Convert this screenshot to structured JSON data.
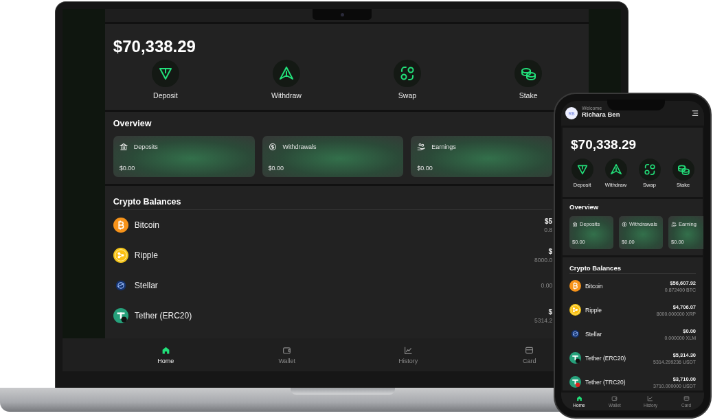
{
  "laptop": {
    "balance": "$70,338.29",
    "actions": [
      {
        "kind": "deposit",
        "label": "Deposit"
      },
      {
        "kind": "withdraw",
        "label": "Withdraw"
      },
      {
        "kind": "swap",
        "label": "Swap"
      },
      {
        "kind": "stake",
        "label": "Stake"
      }
    ],
    "overview": {
      "title": "Overview",
      "cards": [
        {
          "kind": "deposits",
          "label": "Deposits",
          "amount": "$0.00"
        },
        {
          "kind": "withdrawals",
          "label": "Withdrawals",
          "amount": "$0.00"
        },
        {
          "kind": "earnings",
          "label": "Earnings",
          "amount": "$0.00"
        }
      ]
    },
    "crypto": {
      "title": "Crypto Balances",
      "assets": [
        {
          "kind": "bitcoin",
          "name": "Bitcoin",
          "value": "$5",
          "amount": "0.8"
        },
        {
          "kind": "ripple",
          "name": "Ripple",
          "value": "$",
          "amount": "8000.0"
        },
        {
          "kind": "stellar",
          "name": "Stellar",
          "amount": "0.00"
        },
        {
          "kind": "tether-erc",
          "name": "Tether (ERC20)",
          "value": "$",
          "amount": "5314.2"
        }
      ]
    },
    "nav": [
      {
        "kind": "home",
        "label": "Home",
        "selected": true
      },
      {
        "kind": "wallet",
        "label": "Wallet",
        "selected": false
      },
      {
        "kind": "history",
        "label": "History",
        "selected": false
      },
      {
        "kind": "card",
        "label": "Card",
        "selected": false
      }
    ]
  },
  "phone": {
    "avatar": "RB",
    "greeting": "Welcome",
    "user": "Richara Ben",
    "balance": "$70,338.29",
    "actions": [
      {
        "kind": "deposit",
        "label": "Deposit"
      },
      {
        "kind": "withdraw",
        "label": "Withdraw"
      },
      {
        "kind": "swap",
        "label": "Swap"
      },
      {
        "kind": "stake",
        "label": "Stake"
      }
    ],
    "overview": {
      "title": "Overview",
      "cards": [
        {
          "kind": "deposits",
          "label": "Deposits",
          "amount": "$0.00"
        },
        {
          "kind": "withdrawals",
          "label": "Withdrawals",
          "amount": "$0.00"
        },
        {
          "kind": "earnings",
          "label": "Earning",
          "amount": "$0.00"
        }
      ]
    },
    "crypto": {
      "title": "Crypto Balances",
      "assets": [
        {
          "kind": "bitcoin",
          "name": "Bitcoin",
          "value": "$56,607.92",
          "amount": "0.872400 BTC"
        },
        {
          "kind": "ripple",
          "name": "Ripple",
          "value": "$4,706.07",
          "amount": "8000.000000 XRP"
        },
        {
          "kind": "stellar",
          "name": "Stellar",
          "value": "$0.00",
          "amount": "0.000000 XLM"
        },
        {
          "kind": "tether-erc",
          "name": "Tether (ERC20)",
          "value": "$5,314.30",
          "amount": "5314.299236 USDT"
        },
        {
          "kind": "tether-trc",
          "name": "Tether (TRC20)",
          "value": "$3,710.00",
          "amount": "3710.000000 USDT"
        }
      ]
    },
    "nav": [
      {
        "kind": "home",
        "label": "Home",
        "selected": true
      },
      {
        "kind": "wallet",
        "label": "Wallet",
        "selected": false
      },
      {
        "kind": "history",
        "label": "History",
        "selected": false
      },
      {
        "kind": "card",
        "label": "Card",
        "selected": false
      }
    ]
  }
}
